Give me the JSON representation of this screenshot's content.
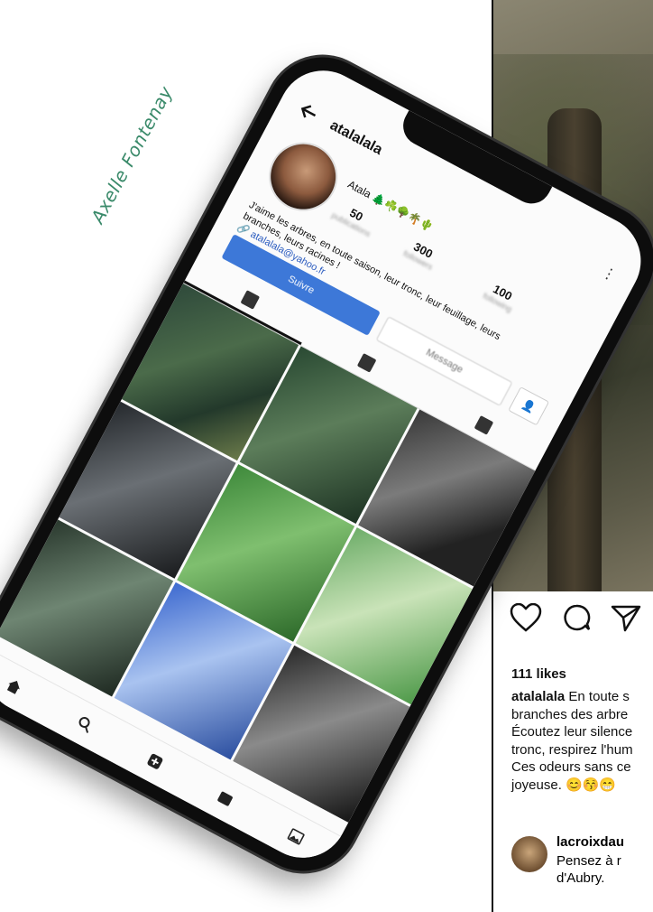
{
  "author_signature": "Axelle Fontenay",
  "profile": {
    "username": "atalalala",
    "display_name": "Atala 🌲☘️🌳🌴🌵",
    "stats": [
      {
        "value": "50",
        "label": "publications"
      },
      {
        "value": "300",
        "label": "followers"
      },
      {
        "value": "100",
        "label": "following"
      }
    ],
    "bio_line1": "J'aime les arbres, en toute saison, leur tronc, leur feuillage, leurs",
    "bio_line2": "branches, leurs racines !",
    "email": "atalalala@yahoo.fr",
    "follow_button": "Suivre",
    "message_button": "Message"
  },
  "post": {
    "likes": "111 likes",
    "caption_user": "atalalala",
    "caption_lines": [
      "En toute s",
      "branches des arbre",
      "Écoutez leur silence",
      "tronc, respirez l'hum",
      "Ces odeurs sans ce",
      "joyeuse. 😊😚😁"
    ],
    "comment": {
      "user": "lacroixdau",
      "lines": [
        "Pensez à r",
        "d'Aubry."
      ]
    }
  }
}
